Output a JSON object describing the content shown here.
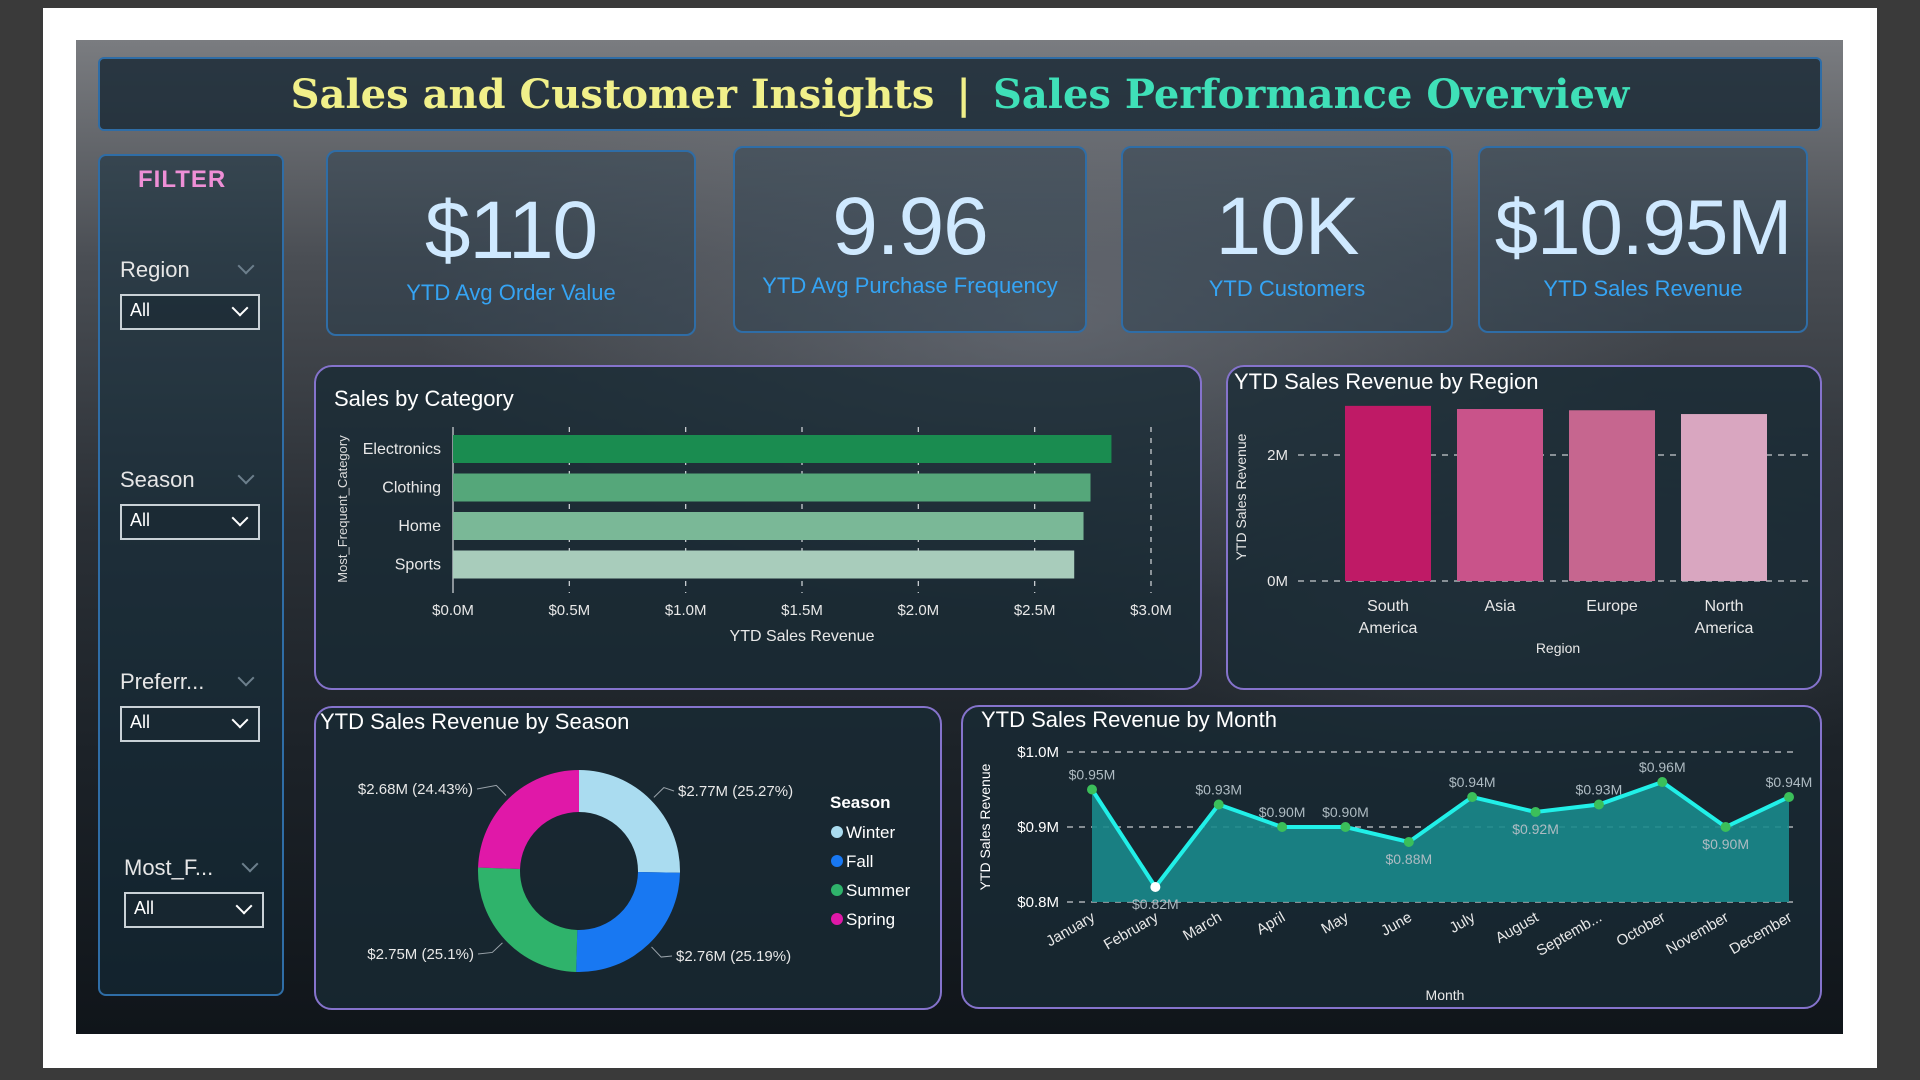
{
  "header": {
    "title_left": "Sales and Customer Insights",
    "separator": "|",
    "title_right": "Sales Performance Overview"
  },
  "filter": {
    "title": "FILTER",
    "slicers": [
      {
        "label": "Region",
        "value": "All"
      },
      {
        "label": "Season",
        "value": "All"
      },
      {
        "label": "Preferr...",
        "value": "All"
      },
      {
        "label": "Most_F...",
        "value": "All"
      }
    ]
  },
  "kpis": [
    {
      "value": "$110",
      "label": "YTD Avg Order Value"
    },
    {
      "value": "9.96",
      "label": "YTD Avg Purchase Frequency"
    },
    {
      "value": "10K",
      "label": "YTD Customers"
    },
    {
      "value": "$10.95M",
      "label": "YTD Sales Revenue"
    }
  ],
  "colors": {
    "title_yellow": "#f1f08a",
    "title_teal": "#3fe0b8",
    "kpi_label": "#35a4f4",
    "filter_title": "#ee8fd6",
    "panel_border": "#8573cc",
    "card_border": "#2f6da6"
  },
  "chart_data": [
    {
      "id": "category",
      "type": "bar",
      "orientation": "horizontal",
      "title": "Sales by Category",
      "xlabel": "YTD Sales Revenue",
      "ylabel": "Most_Frequent_Category",
      "categories": [
        "Electronics",
        "Clothing",
        "Home",
        "Sports"
      ],
      "values": [
        2.83,
        2.74,
        2.71,
        2.67
      ],
      "xlim": [
        0,
        3.0
      ],
      "x_ticks": [
        0,
        0.5,
        1.0,
        1.5,
        2.0,
        2.5,
        3.0
      ],
      "x_tick_labels": [
        "$0.0M",
        "$0.5M",
        "$1.0M",
        "$1.5M",
        "$2.0M",
        "$2.5M",
        "$3.0M"
      ],
      "bar_colors": [
        "#1a8c50",
        "#55a77a",
        "#7ab897",
        "#a8ccbb"
      ],
      "grid": true
    },
    {
      "id": "region",
      "type": "bar",
      "title": "YTD Sales Revenue by Region",
      "xlabel": "Region",
      "ylabel": "YTD Sales Revenue",
      "categories": [
        "South America",
        "Asia",
        "Europe",
        "North America"
      ],
      "category_lines": [
        [
          "South",
          "America"
        ],
        [
          "Asia"
        ],
        [
          "Europe"
        ],
        [
          "North",
          "America"
        ]
      ],
      "values": [
        2.78,
        2.73,
        2.71,
        2.65
      ],
      "ylim": [
        0,
        3.0
      ],
      "y_ticks": [
        0,
        2
      ],
      "y_tick_labels": [
        "0M",
        "2M"
      ],
      "bar_colors": [
        "#bf1a66",
        "#c9538a",
        "#c6668f",
        "#d9a6c0"
      ],
      "grid": true
    },
    {
      "id": "season",
      "type": "pie",
      "donut": true,
      "title": "YTD Sales Revenue by Season",
      "legend_title": "Season",
      "legend_position": "right",
      "labels": [
        "Winter",
        "Fall",
        "Summer",
        "Spring"
      ],
      "values": [
        2.77,
        2.76,
        2.75,
        2.68
      ],
      "percents": [
        25.27,
        25.19,
        25.1,
        24.43
      ],
      "slice_labels": [
        "$2.77M (25.27%)",
        "$2.76M (25.19%)",
        "$2.75M (25.1%)",
        "$2.68M (24.43%)"
      ],
      "colors": [
        "#aadcf0",
        "#1878f2",
        "#2fb36b",
        "#e018a8"
      ]
    },
    {
      "id": "month",
      "type": "area",
      "title": "YTD Sales Revenue by Month",
      "xlabel": "Month",
      "ylabel": "YTD Sales Revenue",
      "x": [
        "January",
        "February",
        "March",
        "April",
        "May",
        "June",
        "July",
        "August",
        "Septemb...",
        "October",
        "November",
        "December"
      ],
      "values": [
        0.95,
        0.82,
        0.93,
        0.9,
        0.9,
        0.88,
        0.94,
        0.92,
        0.93,
        0.96,
        0.9,
        0.94
      ],
      "point_labels": [
        "$0.95M",
        "$0.82M",
        "$0.93M",
        "$0.90M",
        "$0.90M",
        "$0.88M",
        "$0.94M",
        "$0.92M",
        "$0.93M",
        "$0.96M",
        "$0.90M",
        "$0.94M"
      ],
      "ylim": [
        0.8,
        1.0
      ],
      "y_ticks": [
        0.8,
        0.9,
        1.0
      ],
      "y_tick_labels": [
        "$0.8M",
        "$0.9M",
        "$1.0M"
      ],
      "line_color": "#21f0e8",
      "fill_color": "#1a8a8c",
      "grid": true
    }
  ]
}
